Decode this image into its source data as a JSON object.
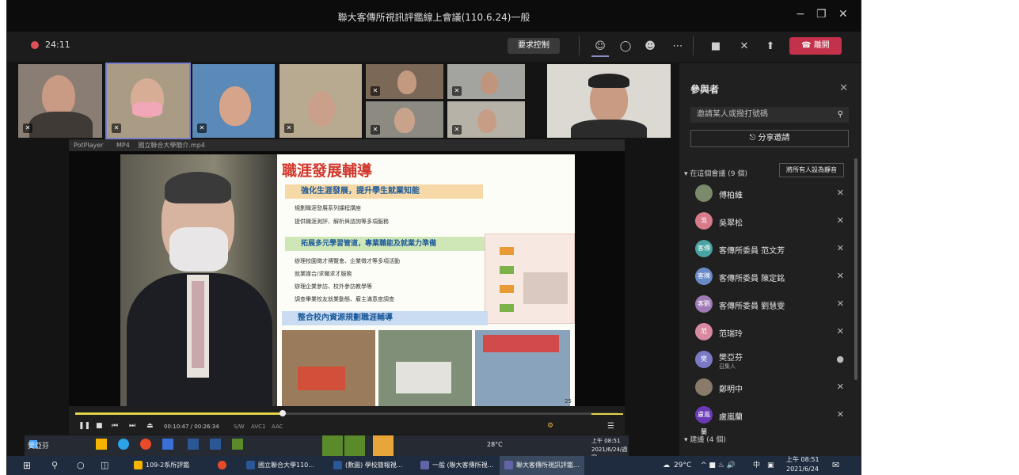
{
  "window": {
    "title": "聯大客傳所視訊評鑑線上會議(110.6.24)一般",
    "minimize": "−",
    "maximize": "❐",
    "close": "✕"
  },
  "meeting": {
    "timer": "24:11",
    "request_control": "要求控制",
    "leave": "離開"
  },
  "player": {
    "app": "PotPlayer",
    "format": "MP4",
    "file": "國立聯合大學簡介.mp4",
    "time": "00:10:47 / 00:26:34",
    "codec1": "S/W",
    "codec2": "AVC1",
    "codec3": "AAC"
  },
  "slide": {
    "title": "職涯發展輔導",
    "section1": "強化生涯發展，提升學生就業知能",
    "bullets1": [
      "規劃職涯發展系列課程講座",
      "提供職涯測評、解析與諮詢等多項服務"
    ],
    "section2": "拓展多元學習管道，專業職能及就業力準備",
    "bullets2": [
      "辦理校園徵才博覽會、企業徵才等多項活動",
      "就業媒合/求職求才服務",
      "辦理企業參訪、校外參訪教學等",
      "調查畢業校友就業動態、雇主滿意度調查"
    ],
    "section3": "整合校內資源規劃職涯輔導",
    "page": "25"
  },
  "panel": {
    "title": "參與者",
    "invite_placeholder": "邀請某人或撥打號碼",
    "share_invite": "分享邀請",
    "in_meeting": "在這個會議 (9 個)",
    "mute_all": "將所有人設為靜音",
    "suggested": "建議 (4 個)",
    "participants": [
      {
        "name": "傅柏維",
        "role": "",
        "avatar": ""
      },
      {
        "name": "吳翠松",
        "role": "",
        "avatar": "吳"
      },
      {
        "name": "客傳所委員 范文芳",
        "role": "",
        "avatar": "客傳"
      },
      {
        "name": "客傳所委員 陳定銘",
        "role": "",
        "avatar": "客陳"
      },
      {
        "name": "客傳所委員 劉慧雯",
        "role": "",
        "avatar": "客劉"
      },
      {
        "name": "范瑞玲",
        "role": "",
        "avatar": "范"
      },
      {
        "name": "樊亞芬",
        "role": "召集人",
        "avatar": "樊"
      },
      {
        "name": "鄭明中",
        "role": "",
        "avatar": ""
      },
      {
        "name": "盧嵐蘭",
        "role": "",
        "avatar": "盧嵐蘭"
      }
    ]
  },
  "inner_taskbar": {
    "user": "樊亞芬",
    "temp": "28°C",
    "time": "上午 08:51",
    "date": "2021/6/24/週四"
  },
  "taskbar": {
    "items": [
      "109-2系所評鑑",
      "國立聯合大學110...",
      "(數圖) 學校簡報視...",
      "一般 (聯大客傳所視...",
      "聯大客傳所視訊評鑑..."
    ],
    "temp": "29°C",
    "ime": "中",
    "time": "上午 08:51",
    "date": "2021/6/24"
  }
}
